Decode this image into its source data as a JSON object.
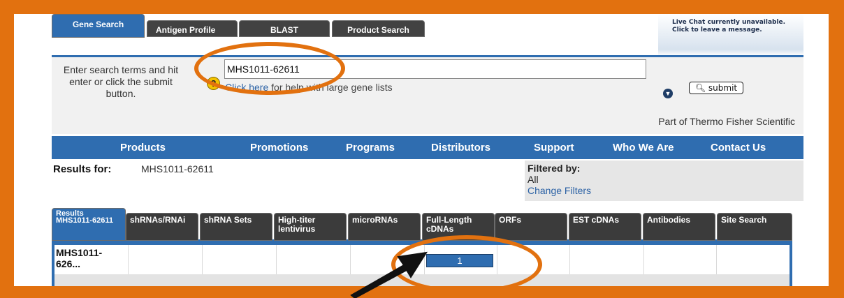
{
  "livechat": {
    "line1": "Live Chat currently unavailable.",
    "line2": "Click to leave a message."
  },
  "search_tabs": [
    "Gene Search",
    "Antigen Profile",
    "BLAST",
    "Product Search"
  ],
  "search": {
    "hint": "Enter search terms and hit enter or click the submit button.",
    "help_icon": "?",
    "value": "MHS1011-62611",
    "help_link": "Click here",
    "help_rest": "for help with large gene lists",
    "submit_label": "submit"
  },
  "brand": "Part of Thermo Fisher Scientific",
  "nav": [
    "Products",
    "Promotions",
    "Programs",
    "Distributors",
    "Support",
    "Who We Are",
    "Contact Us"
  ],
  "results": {
    "label": "Results for:",
    "value": "MHS1011-62611",
    "filter_title": "Filtered by:",
    "filter_value": "All",
    "change_filters": "Change Filters"
  },
  "result_tabs": [
    "Results MHS1011-62611",
    "shRNAs/RNAi",
    "shRNA Sets",
    "High-titer lentivirus",
    "microRNAs",
    "Full-Length cDNAs",
    "ORFs",
    "EST cDNAs",
    "Antibodies",
    "Site Search"
  ],
  "result_row": {
    "label": "MHS1011-626...",
    "full_length_count": "1"
  },
  "colors": {
    "accent_orange": "#e2710f",
    "brand_blue": "#2f6db0",
    "tab_dark": "#3b3b3b"
  }
}
